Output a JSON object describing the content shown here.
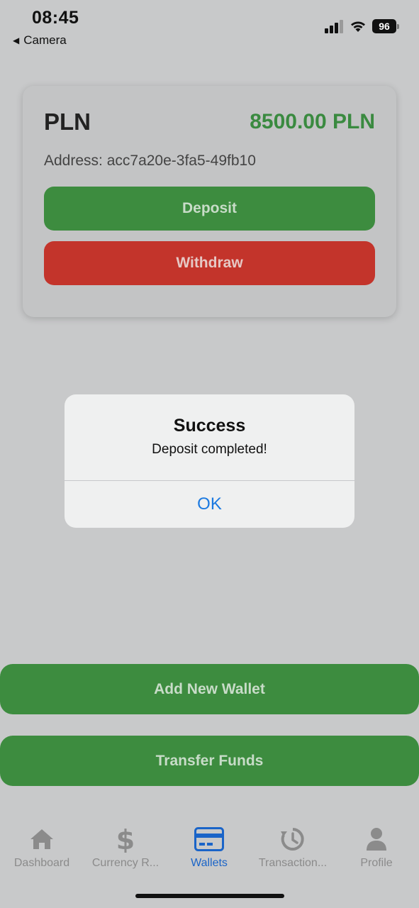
{
  "status_bar": {
    "time": "08:45",
    "back_label": "Camera",
    "battery": "96"
  },
  "wallet": {
    "currency": "PLN",
    "balance": "8500.00 PLN",
    "address": "Address: acc7a20e-3fa5-49fb10",
    "deposit_label": "Deposit",
    "withdraw_label": "Withdraw"
  },
  "alert": {
    "title": "Success",
    "message": "Deposit completed!",
    "ok_label": "OK"
  },
  "actions": {
    "add_wallet_label": "Add New Wallet",
    "transfer_label": "Transfer Funds"
  },
  "tabs": [
    {
      "label": "Dashboard",
      "icon": "home-icon",
      "active": false
    },
    {
      "label": "Currency R...",
      "icon": "dollar-icon",
      "active": false
    },
    {
      "label": "Wallets",
      "icon": "card-icon",
      "active": true
    },
    {
      "label": "Transaction...",
      "icon": "history-icon",
      "active": false
    },
    {
      "label": "Profile",
      "icon": "person-icon",
      "active": false
    }
  ],
  "colors": {
    "accent_green": "#3d8c3f",
    "danger_red": "#c3342b",
    "active_tab_blue": "#1a64c8",
    "link_blue": "#1b79e0"
  }
}
